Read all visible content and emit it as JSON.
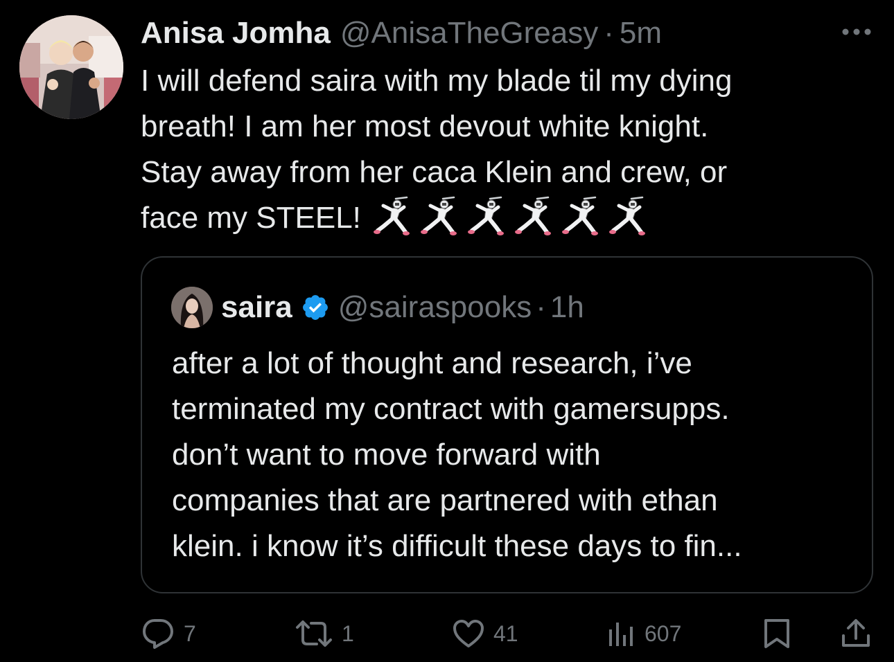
{
  "tweet": {
    "display_name": "Anisa Jomha",
    "handle": "@AnisaTheGreasy",
    "separator": "·",
    "time": "5m",
    "more_icon": "more-horizontal-icon",
    "text_lines": [
      "I will defend saira with my blade til my dying",
      "breath! I am her most devout white knight.",
      "Stay away from her caca Klein and crew, or",
      "face my STEEL!"
    ],
    "emoji": [
      "fencer",
      "fencer",
      "fencer",
      "fencer",
      "fencer",
      "fencer"
    ]
  },
  "quoted_tweet": {
    "display_name": "saira",
    "verified_icon": "verified-badge-icon",
    "handle": "@sairaspooks",
    "separator": "·",
    "time": "1h",
    "text_lines": [
      "after a lot of thought and research, i’ve",
      "terminated my contract with gamersupps.",
      "don’t want to move forward with",
      "companies that are partnered with ethan",
      "klein. i know it’s difficult these days to fin..."
    ]
  },
  "actions": {
    "reply": {
      "icon": "reply-icon",
      "count": "7"
    },
    "retweet": {
      "icon": "retweet-icon",
      "count": "1"
    },
    "like": {
      "icon": "heart-icon",
      "count": "41"
    },
    "views": {
      "icon": "views-chart-icon",
      "count": "607"
    },
    "bookmark": {
      "icon": "bookmark-icon"
    },
    "share": {
      "icon": "share-icon"
    }
  },
  "colors": {
    "background": "#000000",
    "primary_text": "#e7e9ea",
    "secondary_text": "#71767b",
    "border": "#2f3336",
    "verified": "#1d9bf0"
  }
}
